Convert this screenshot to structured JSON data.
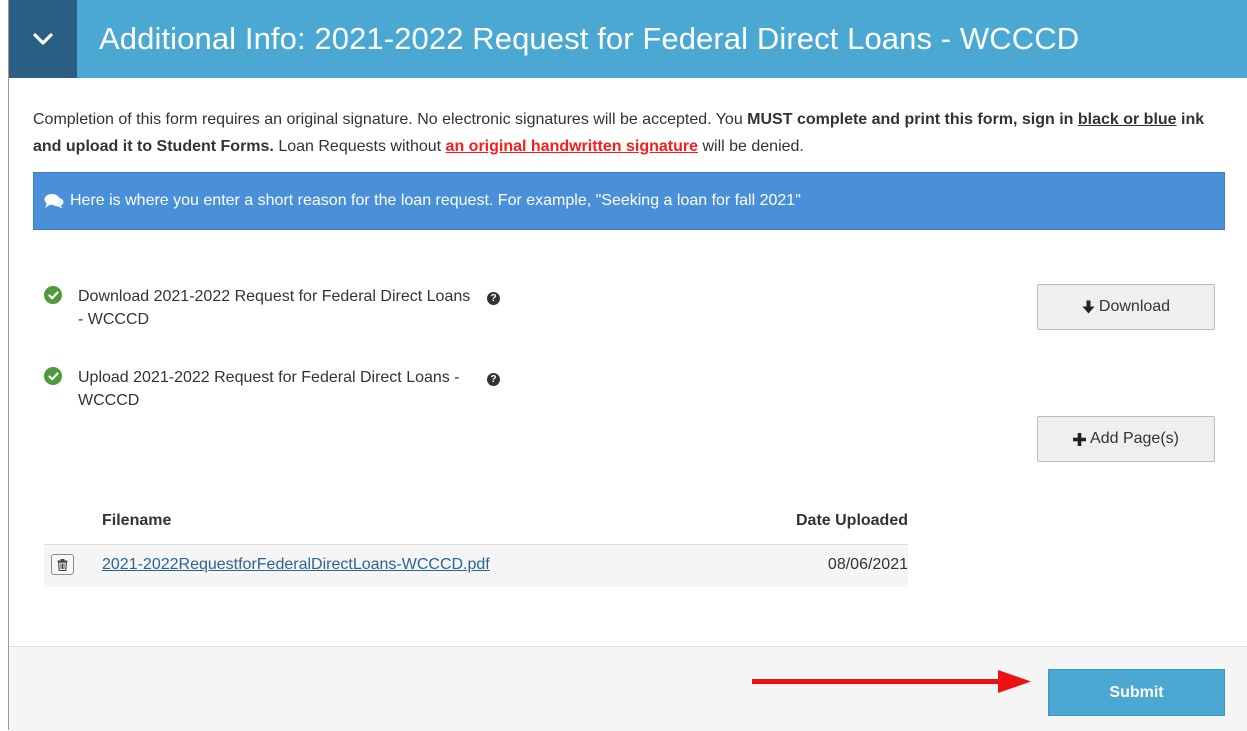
{
  "header": {
    "title": "Additional Info: 2021-2022 Request for Federal Direct Loans - WCCCD",
    "toggle_icon": "chevron-down-icon",
    "colors": {
      "bar": "#4ba8d2",
      "toggle": "#2b5f84"
    }
  },
  "intro": {
    "part1": "Completion of this form requires an original signature. No electronic signatures will be accepted. You ",
    "bold1": "MUST complete and print this form, sign in ",
    "underline1": "black or blue",
    "bold2": " ink and upload it to Student Forms.",
    "part2": " Loan Requests without ",
    "red_link": "an original handwritten signature",
    "part3": " will be denied."
  },
  "info_banner": {
    "icon": "comments-icon",
    "text": "Here is where you enter a short reason for the loan request. For example, \"Seeking a loan for fall 2021\"",
    "color": "#4a90d9"
  },
  "steps": [
    {
      "label": "Download 2021-2022 Request for Federal Direct Loans - WCCCD",
      "status_icon": "check-circle-icon",
      "help_icon": "question-circle-icon"
    },
    {
      "label": "Upload 2021-2022 Request for Federal Direct Loans - WCCCD",
      "status_icon": "check-circle-icon",
      "help_icon": "question-circle-icon"
    }
  ],
  "buttons": {
    "download": {
      "label": "Download",
      "icon": "arrow-down-icon"
    },
    "add_pages": {
      "label": "Add Page(s)",
      "icon": "plus-icon"
    }
  },
  "files_table": {
    "headers": [
      "Filename",
      "Date Uploaded"
    ],
    "rows": [
      {
        "filename": "2021-2022RequestforFederalDirectLoans-WCCCD.pdf",
        "date": "08/06/2021",
        "delete_icon": "trash-icon"
      }
    ]
  },
  "footer": {
    "submit_label": "Submit",
    "annotation_arrow_color": "#ee1111"
  }
}
